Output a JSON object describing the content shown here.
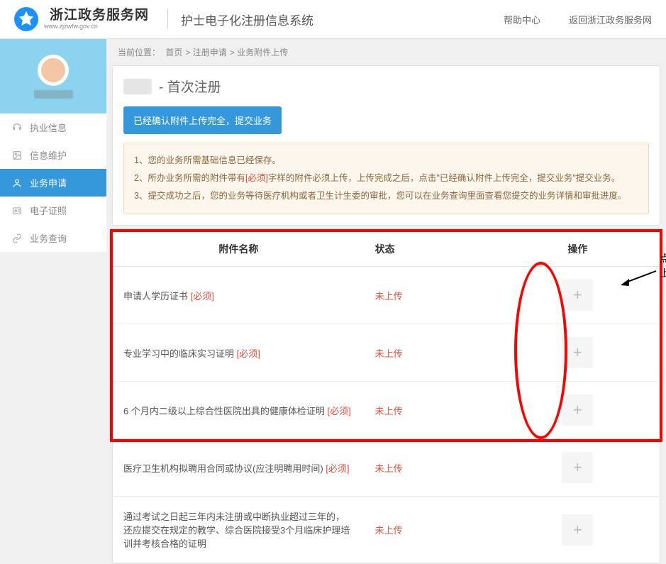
{
  "header": {
    "logo_main": "浙江政务服务网",
    "logo_sub": "www.zjzwfw.gov.cn",
    "system_title": "护士电子化注册信息系统",
    "help": "帮助中心",
    "back": "返回浙江政务服务网"
  },
  "sidebar": {
    "items": [
      {
        "label": "执业信息",
        "icon": "headset"
      },
      {
        "label": "信息维护",
        "icon": "image"
      },
      {
        "label": "业务申请",
        "icon": "user",
        "active": true
      },
      {
        "label": "电子证照",
        "icon": "id"
      },
      {
        "label": "业务查询",
        "icon": "link"
      }
    ]
  },
  "breadcrumb": {
    "label": "当前位置：",
    "items": [
      "首页",
      "注册申请",
      "业务附件上传"
    ]
  },
  "page": {
    "title_suffix": "- 首次注册",
    "submit_btn": "已经确认附件上传完全，提交业务"
  },
  "notice": {
    "line1": "1、您的业务所需基础信息已经保存。",
    "line2_pre": "2、所办业务所需的附件带有",
    "line2_tag": "[必须]",
    "line2_post": "字样的附件必须上传，上传完成之后，点击\"已经确认附件上传完全，提交业务\"提交业务。",
    "line3": "3、提交成功之后，您的业务等待医疗机构或者卫生计生委的审批，您可以在业务查询里面查看您提交的业务详情和审批进度。"
  },
  "table": {
    "headers": {
      "name": "附件名称",
      "status": "状态",
      "action": "操作"
    },
    "required_tag": "[必须]",
    "rows": [
      {
        "name": "申请人学历证书 ",
        "required": true,
        "status": "未上传"
      },
      {
        "name": "专业学习中的临床实习证明 ",
        "required": true,
        "status": "未上传"
      },
      {
        "name": "6 个月内二级以上综合性医院出具的健康体检证明 ",
        "required": true,
        "status": "未上传"
      },
      {
        "name": "医疗卫生机构拟聘用合同或协议(应注明聘用时间) ",
        "required": true,
        "status": "未上传"
      },
      {
        "name": "通过考试之日起三年内未注册或中断执业超过三年的，还应提交在规定的教学、综合医院接受3个月临床护理培训并考核合格的证明",
        "required": false,
        "status": "未上传"
      }
    ]
  },
  "annotation": {
    "text": "点击\"+\"，按要求上传材料。"
  }
}
